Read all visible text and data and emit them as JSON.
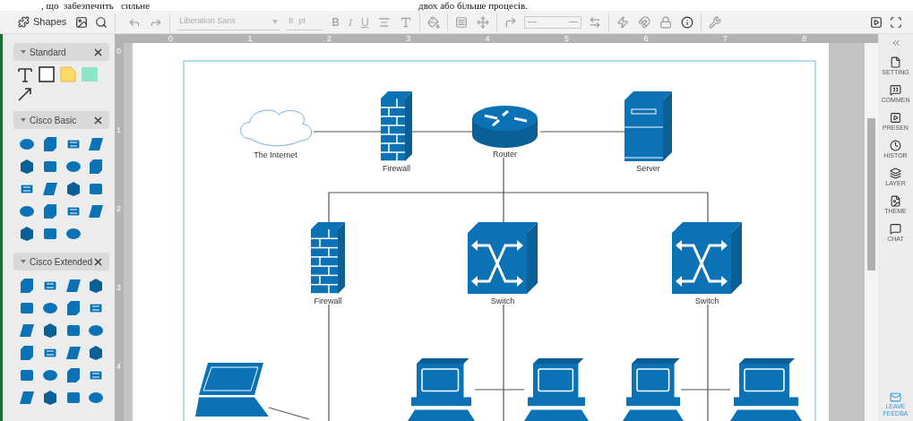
{
  "document_text": [
    ", що  забезпечить   сильне",
    "двох або більше процесів."
  ],
  "toolbar": {
    "shapes_label": "Shapes",
    "font": "Liberation Sans",
    "font_size": "8",
    "size_unit": "pt",
    "format_buttons": [
      "B",
      "I",
      "U"
    ]
  },
  "shape_panel": {
    "sections": [
      {
        "title": "Standard",
        "expanded": true,
        "kind": "standard"
      },
      {
        "title": "Cisco Basic",
        "expanded": true,
        "kind": "basic"
      },
      {
        "title": "Cisco Extended",
        "expanded": true,
        "kind": "extended"
      }
    ]
  },
  "rulers": {
    "horizontal": [
      "0",
      "1",
      "2",
      "3",
      "4",
      "5",
      "6",
      "7",
      "8"
    ],
    "vertical": [
      "0",
      "1",
      "2",
      "3",
      "4"
    ]
  },
  "diagram": {
    "nodes": [
      {
        "kind": "cloud",
        "label": "The Internet"
      },
      {
        "kind": "firewall",
        "label": "Firewall"
      },
      {
        "kind": "router",
        "label": "Router"
      },
      {
        "kind": "server",
        "label": "Server"
      },
      {
        "kind": "firewall",
        "label": "Firewall"
      },
      {
        "kind": "switch",
        "label": "Switch"
      },
      {
        "kind": "switch",
        "label": "Switch"
      },
      {
        "kind": "laptop"
      },
      {
        "kind": "computer"
      },
      {
        "kind": "computer"
      },
      {
        "kind": "computer"
      },
      {
        "kind": "computer"
      }
    ]
  },
  "right_panel": {
    "items": [
      "SETTING",
      "COMMEN",
      "PRESEN",
      "HISTOR",
      "LAYER",
      "THEME",
      "CHAT"
    ],
    "feedback": [
      "LEAVE",
      "FEEDBA"
    ]
  }
}
